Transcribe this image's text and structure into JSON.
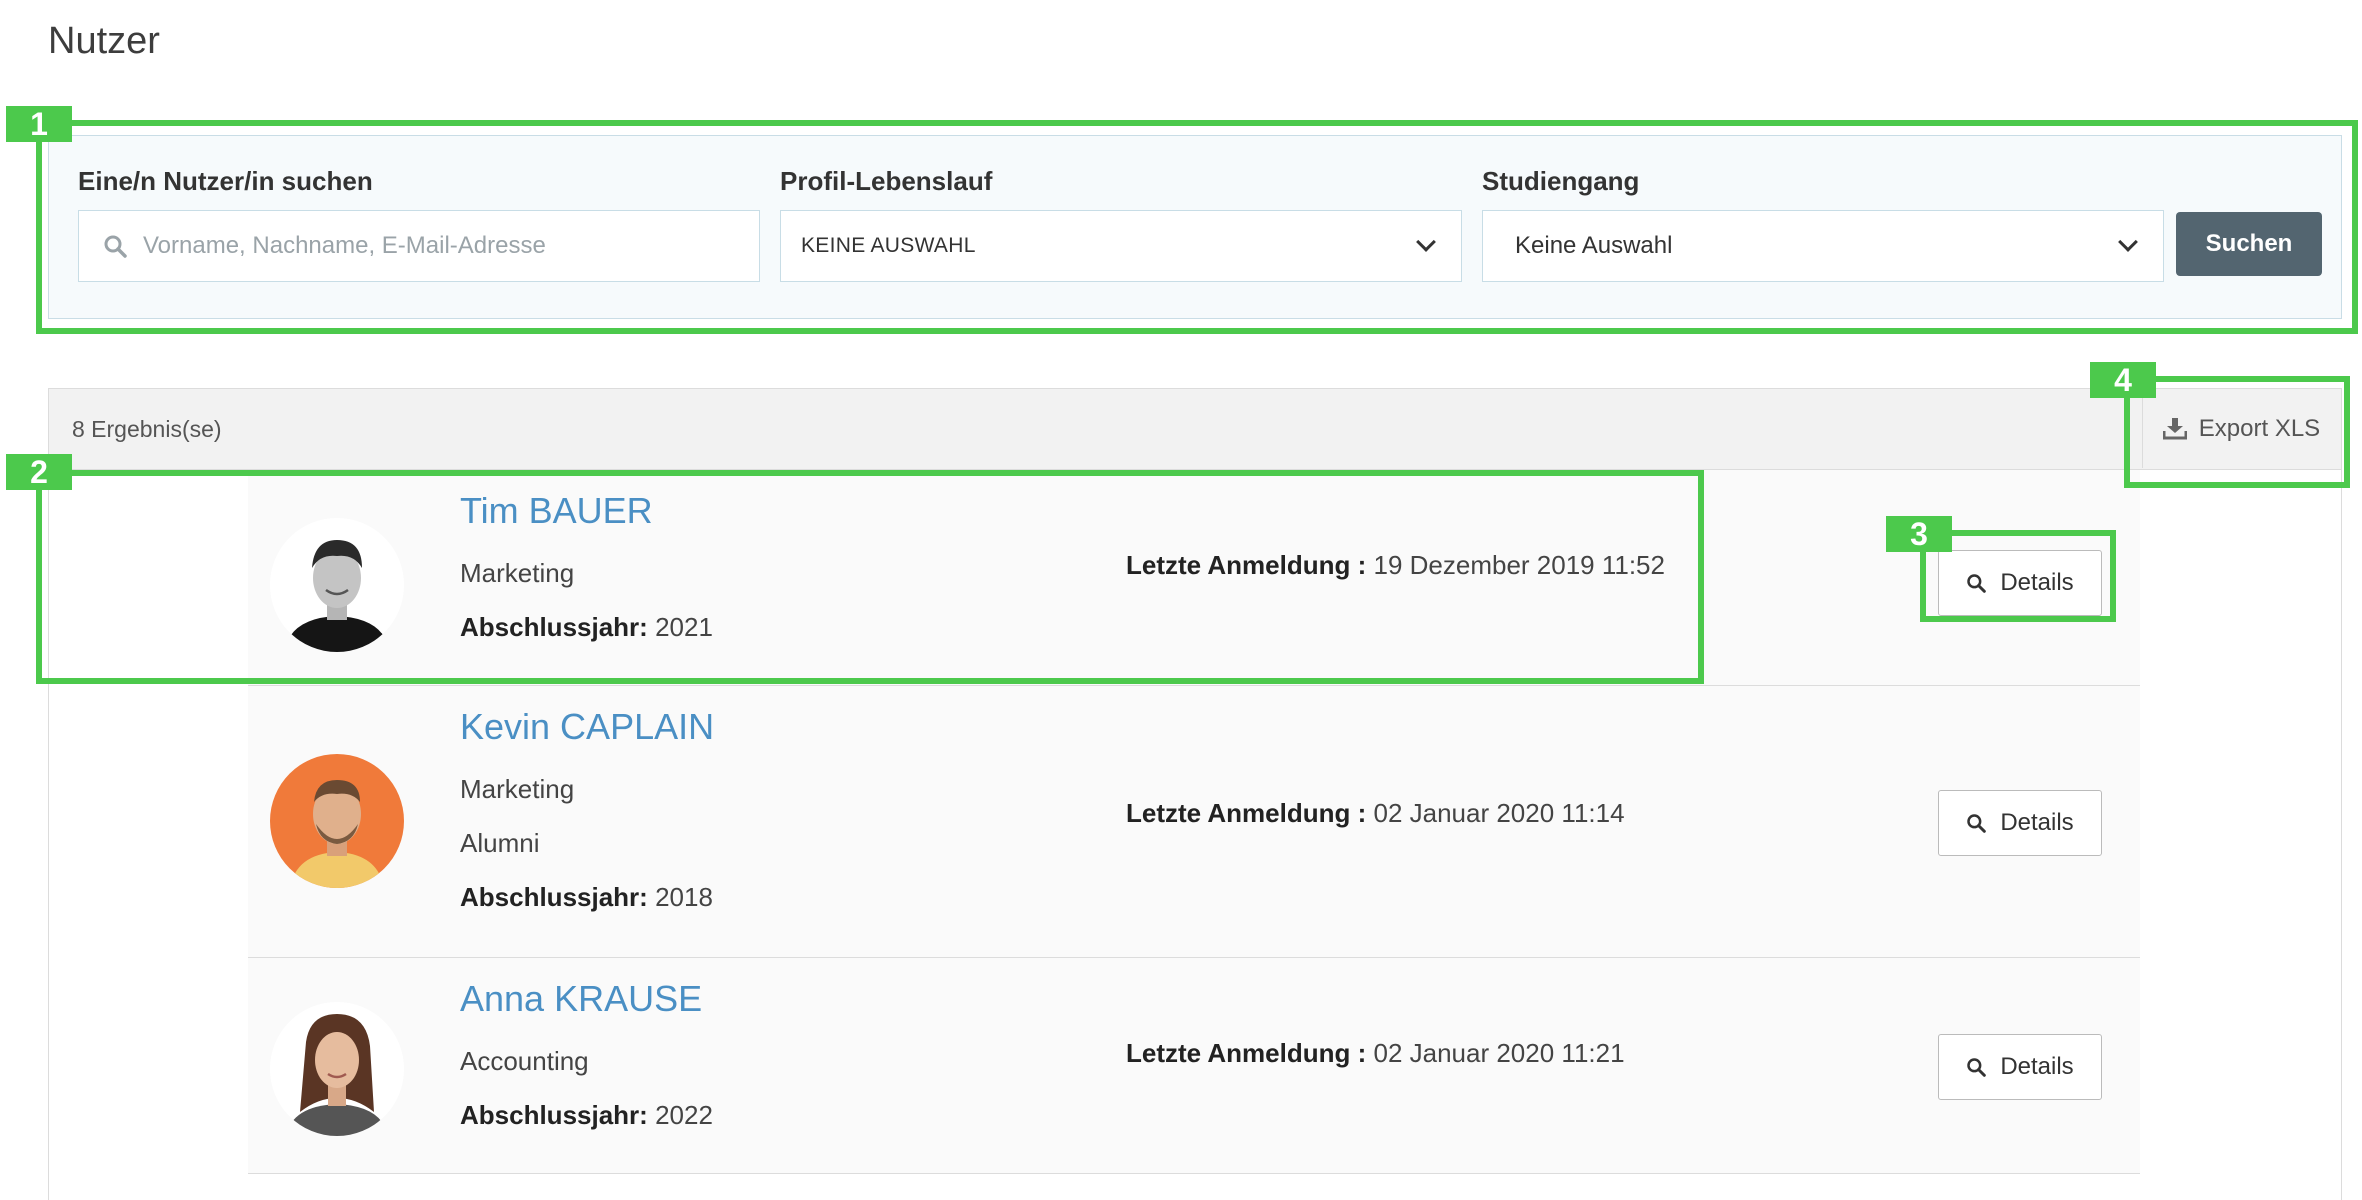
{
  "page": {
    "title": "Nutzer"
  },
  "filters": {
    "search_label": "Eine/n Nutzer/in suchen",
    "search_placeholder": "Vorname, Nachname, E-Mail-Adresse",
    "profile_label": "Profil-Lebenslauf",
    "profile_value": "KEINE AUSWAHL",
    "study_label": "Studiengang",
    "study_value": "Keine Auswahl",
    "search_button": "Suchen"
  },
  "results": {
    "count": "8 Ergebnis(se)",
    "export_label": "Export XLS",
    "login_label": "Letzte Anmeldung :",
    "year_label": "Abschlussjahr:",
    "details_label": "Details",
    "users": [
      {
        "name": "Tim BAUER",
        "program": "Marketing",
        "status": "",
        "year": "2021",
        "last_login": "19 Dezember 2019 11:52"
      },
      {
        "name": "Kevin CAPLAIN",
        "program": "Marketing",
        "status": "Alumni",
        "year": "2018",
        "last_login": "02 Januar 2020 11:14"
      },
      {
        "name": "Anna KRAUSE",
        "program": "Accounting",
        "status": "",
        "year": "2022",
        "last_login": "02 Januar 2020 11:21"
      }
    ]
  },
  "annotations": [
    "1",
    "2",
    "3",
    "4"
  ],
  "colors": {
    "annotation": "#4cc94c",
    "link": "#4a8fc4",
    "primary_button": "#536570"
  }
}
